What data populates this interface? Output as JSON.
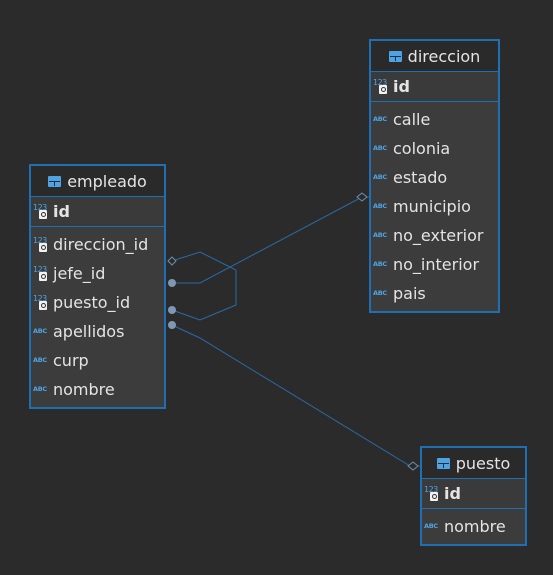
{
  "colors": {
    "background": "#2b2b2b",
    "entity_fill": "#3c3c3c",
    "entity_border": "#1f6fb5",
    "text": "#e4e4e4",
    "type_icon": "#4fa3e3",
    "link_line": "#2a6aa8"
  },
  "entities": {
    "empleado": {
      "name": "empleado",
      "pk": {
        "type": "123",
        "label": "id"
      },
      "columns": [
        {
          "type": "123",
          "label": "direccion_id",
          "key": true
        },
        {
          "type": "123",
          "label": "jefe_id",
          "key": true
        },
        {
          "type": "123",
          "label": "puesto_id",
          "key": true
        },
        {
          "type": "ABC",
          "label": "apellidos"
        },
        {
          "type": "ABC",
          "label": "curp"
        },
        {
          "type": "ABC",
          "label": "nombre"
        }
      ]
    },
    "direccion": {
      "name": "direccion",
      "pk": {
        "type": "123",
        "label": "id"
      },
      "columns": [
        {
          "type": "ABC",
          "label": "calle"
        },
        {
          "type": "ABC",
          "label": "colonia"
        },
        {
          "type": "ABC",
          "label": "estado"
        },
        {
          "type": "ABC",
          "label": "municipio"
        },
        {
          "type": "ABC",
          "label": "no_exterior"
        },
        {
          "type": "ABC",
          "label": "no_interior"
        },
        {
          "type": "ABC",
          "label": "pais"
        }
      ]
    },
    "puesto": {
      "name": "puesto",
      "pk": {
        "type": "123",
        "label": "id"
      },
      "columns": [
        {
          "type": "ABC",
          "label": "nombre"
        }
      ]
    }
  },
  "relationships": [
    {
      "from": "empleado.direccion_id",
      "to": "direccion.id"
    },
    {
      "from": "empleado.jefe_id",
      "to": "empleado.id"
    },
    {
      "from": "empleado.puesto_id",
      "to": "puesto.id"
    }
  ]
}
